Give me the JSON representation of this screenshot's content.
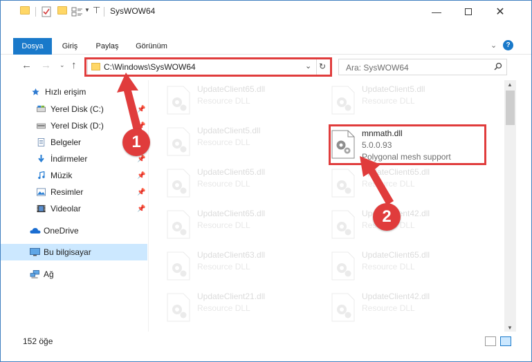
{
  "window": {
    "title": "SysWOW64",
    "accent": "#1979ca",
    "annotation_color": "#e03c3c"
  },
  "ribbon": {
    "tabs": [
      {
        "label": "Dosya",
        "active": true
      },
      {
        "label": "Giriş"
      },
      {
        "label": "Paylaş"
      },
      {
        "label": "Görünüm"
      }
    ]
  },
  "navigation": {
    "address": "C:\\Windows\\SysWOW64",
    "search_placeholder": "Ara: SysWOW64"
  },
  "sidebar": {
    "quick_access": "Hızlı erişim",
    "items": [
      {
        "label": "Yerel Disk (C:)",
        "icon": "drive-icon"
      },
      {
        "label": "Yerel Disk (D:)",
        "icon": "drive-icon"
      },
      {
        "label": "Belgeler",
        "icon": "documents-icon"
      },
      {
        "label": "İndirmeler",
        "icon": "downloads-icon"
      },
      {
        "label": "Müzik",
        "icon": "music-icon"
      },
      {
        "label": "Resimler",
        "icon": "pictures-icon"
      },
      {
        "label": "Videolar",
        "icon": "videos-icon"
      }
    ],
    "onedrive": "OneDrive",
    "this_pc": "Bu bilgisayar",
    "network": "Ağ"
  },
  "files": {
    "highlighted": {
      "name": "mnmath.dll",
      "version": "5.0.0.93",
      "description": "Polygonal mesh support"
    },
    "left_column": [
      {
        "name": "UpdateClient65.dll",
        "type": "Resource DLL"
      },
      {
        "name": "UpdateClient5.dll",
        "type": "Resource DLL"
      },
      {
        "name": "UpdateClient65.dll",
        "type": "Resource DLL"
      },
      {
        "name": "UpdateClient65.dll",
        "type": "Resource DLL"
      },
      {
        "name": "UpdateClient63.dll",
        "type": "Resource DLL"
      },
      {
        "name": "UpdateClient21.dll",
        "type": "Resource DLL"
      }
    ],
    "right_column": [
      {
        "name": "UpdateClient5.dll",
        "type": "Resource DLL"
      },
      {
        "name": "UpdateClient65.dll",
        "type": "Resource DLL"
      },
      {
        "name": "UpdateClient42.dll",
        "type": "Resource DLL"
      },
      {
        "name": "UpdateClient65.dll",
        "type": "Resource DLL"
      },
      {
        "name": "UpdateClient42.dll",
        "type": "Resource DLL"
      }
    ]
  },
  "status": {
    "count": "152 öğe"
  },
  "annotations": {
    "badge1": "1",
    "badge2": "2"
  }
}
